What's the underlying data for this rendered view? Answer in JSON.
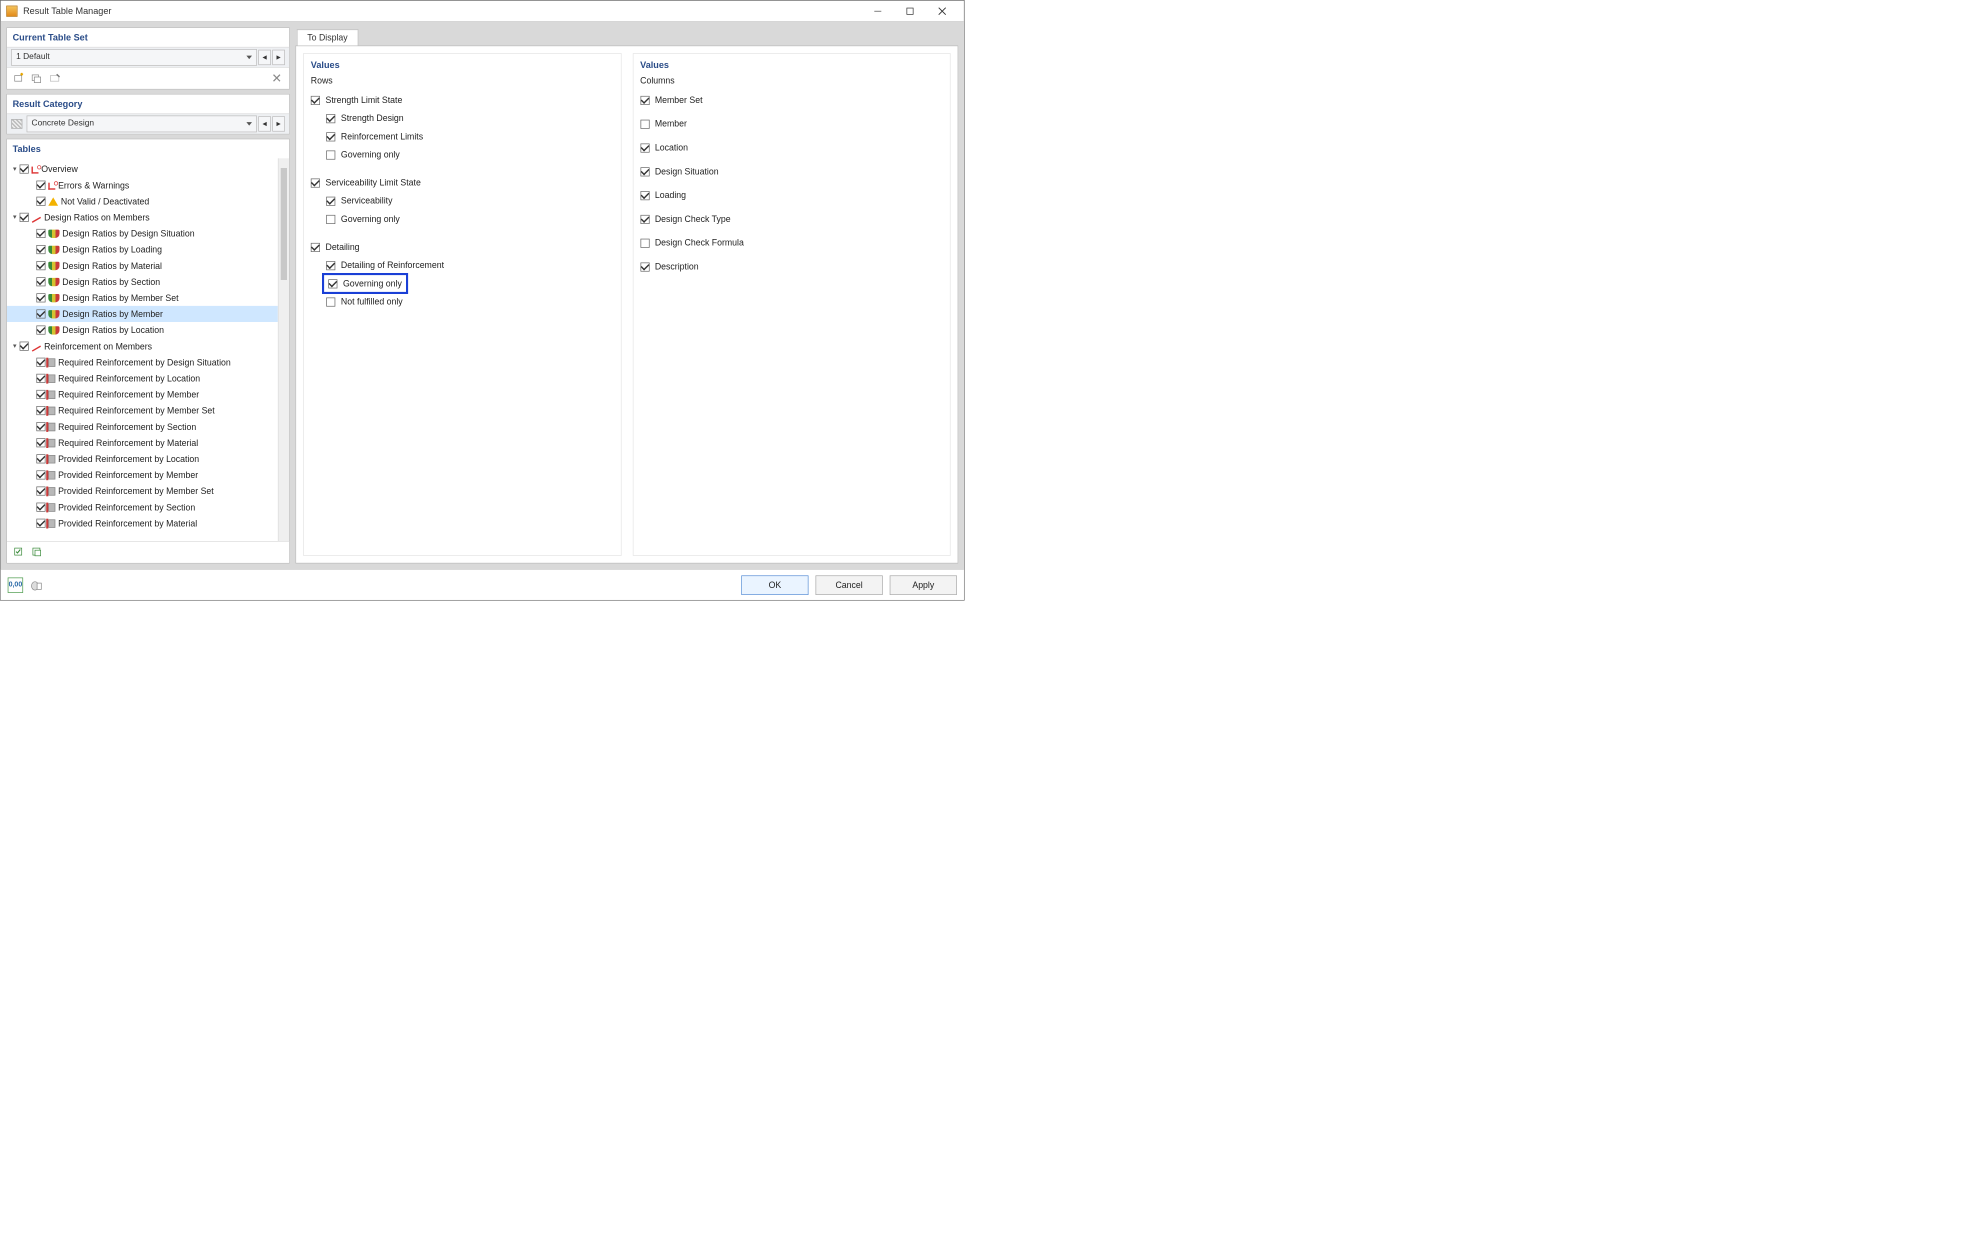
{
  "window": {
    "title": "Result Table Manager"
  },
  "left": {
    "current_table_set": {
      "header": "Current Table Set",
      "value": "1  Default"
    },
    "result_category": {
      "header": "Result Category",
      "value": "Concrete Design"
    },
    "tables_header": "Tables",
    "tree": [
      {
        "level": 0,
        "expander": "▾",
        "checked": true,
        "icon": "overview",
        "label": "Overview"
      },
      {
        "level": 1,
        "expander": "",
        "checked": true,
        "icon": "overview",
        "label": "Errors & Warnings"
      },
      {
        "level": 1,
        "expander": "",
        "checked": true,
        "icon": "warn",
        "label": "Not Valid / Deactivated"
      },
      {
        "level": 0,
        "expander": "▾",
        "checked": true,
        "icon": "pencil",
        "label": "Design Ratios on Members"
      },
      {
        "level": 1,
        "expander": "",
        "checked": true,
        "icon": "ratio",
        "label": "Design Ratios by Design Situation"
      },
      {
        "level": 1,
        "expander": "",
        "checked": true,
        "icon": "ratio",
        "label": "Design Ratios by Loading"
      },
      {
        "level": 1,
        "expander": "",
        "checked": true,
        "icon": "ratio",
        "label": "Design Ratios by Material"
      },
      {
        "level": 1,
        "expander": "",
        "checked": true,
        "icon": "ratio",
        "label": "Design Ratios by Section"
      },
      {
        "level": 1,
        "expander": "",
        "checked": true,
        "icon": "ratio",
        "label": "Design Ratios by Member Set"
      },
      {
        "level": 1,
        "expander": "",
        "checked": true,
        "icon": "ratio",
        "label": "Design Ratios by Member",
        "selected": true
      },
      {
        "level": 1,
        "expander": "",
        "checked": true,
        "icon": "ratio",
        "label": "Design Ratios by Location"
      },
      {
        "level": 0,
        "expander": "▾",
        "checked": true,
        "icon": "pencil",
        "label": "Reinforcement on Members"
      },
      {
        "level": 1,
        "expander": "",
        "checked": true,
        "icon": "rebar",
        "label": "Required Reinforcement by Design Situation"
      },
      {
        "level": 1,
        "expander": "",
        "checked": true,
        "icon": "rebar",
        "label": "Required Reinforcement by Location"
      },
      {
        "level": 1,
        "expander": "",
        "checked": true,
        "icon": "rebar",
        "label": "Required Reinforcement by Member"
      },
      {
        "level": 1,
        "expander": "",
        "checked": true,
        "icon": "rebar",
        "label": "Required Reinforcement by Member Set"
      },
      {
        "level": 1,
        "expander": "",
        "checked": true,
        "icon": "rebar",
        "label": "Required Reinforcement by Section"
      },
      {
        "level": 1,
        "expander": "",
        "checked": true,
        "icon": "rebar",
        "label": "Required Reinforcement by Material"
      },
      {
        "level": 1,
        "expander": "",
        "checked": true,
        "icon": "rebar",
        "label": "Provided Reinforcement by Location"
      },
      {
        "level": 1,
        "expander": "",
        "checked": true,
        "icon": "rebar",
        "label": "Provided Reinforcement by Member"
      },
      {
        "level": 1,
        "expander": "",
        "checked": true,
        "icon": "rebar",
        "label": "Provided Reinforcement by Member Set"
      },
      {
        "level": 1,
        "expander": "",
        "checked": true,
        "icon": "rebar",
        "label": "Provided Reinforcement by Section"
      },
      {
        "level": 1,
        "expander": "",
        "checked": true,
        "icon": "rebar",
        "label": "Provided Reinforcement by Material"
      }
    ]
  },
  "display": {
    "tab": "To Display",
    "rows_title": "Values",
    "rows_subtitle": "Rows",
    "groups": [
      {
        "label": "Strength Limit State",
        "checked": true,
        "children": [
          {
            "label": "Strength Design",
            "checked": true
          },
          {
            "label": "Reinforcement Limits",
            "checked": true
          },
          {
            "label": "Governing only",
            "checked": false
          }
        ]
      },
      {
        "label": "Serviceability Limit State",
        "checked": true,
        "children": [
          {
            "label": "Serviceability",
            "checked": true
          },
          {
            "label": "Governing only",
            "checked": false
          }
        ]
      },
      {
        "label": "Detailing",
        "checked": true,
        "children": [
          {
            "label": "Detailing of Reinforcement",
            "checked": true
          },
          {
            "label": "Governing only",
            "checked": true,
            "highlight": true
          },
          {
            "label": "Not fulfilled only",
            "checked": false
          }
        ]
      }
    ],
    "cols_title": "Values",
    "cols_subtitle": "Columns",
    "columns": [
      {
        "label": "Member Set",
        "checked": true
      },
      {
        "label": "Member",
        "checked": false
      },
      {
        "label": "Location",
        "checked": true
      },
      {
        "label": "Design Situation",
        "checked": true
      },
      {
        "label": "Loading",
        "checked": true
      },
      {
        "label": "Design Check Type",
        "checked": true
      },
      {
        "label": "Design Check Formula",
        "checked": false
      },
      {
        "label": "Description",
        "checked": true
      }
    ]
  },
  "footer": {
    "ok": "OK",
    "cancel": "Cancel",
    "apply": "Apply",
    "decimals_icon": "0,00"
  }
}
